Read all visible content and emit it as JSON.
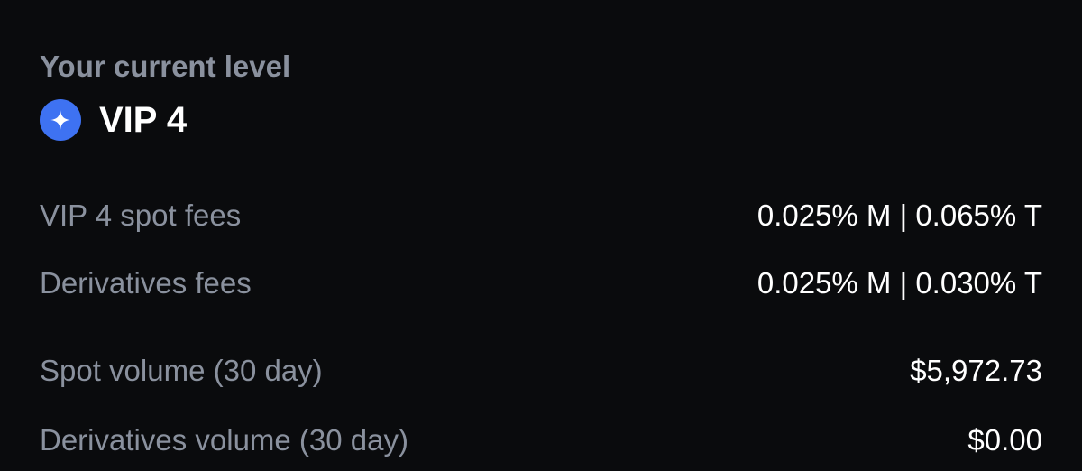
{
  "level": {
    "caption": "Your current level",
    "icon": "sparkle-icon",
    "icon_color": "#3e72f2",
    "name": "VIP 4"
  },
  "fees": [
    {
      "label": "VIP 4 spot fees",
      "value": "0.025% M | 0.065% T"
    },
    {
      "label": "Derivatives fees",
      "value": "0.025% M | 0.030% T"
    }
  ],
  "volumes": [
    {
      "label": "Spot volume (30 day)",
      "value": "$5,972.73"
    },
    {
      "label": "Derivatives volume (30 day)",
      "value": "$0.00"
    }
  ]
}
